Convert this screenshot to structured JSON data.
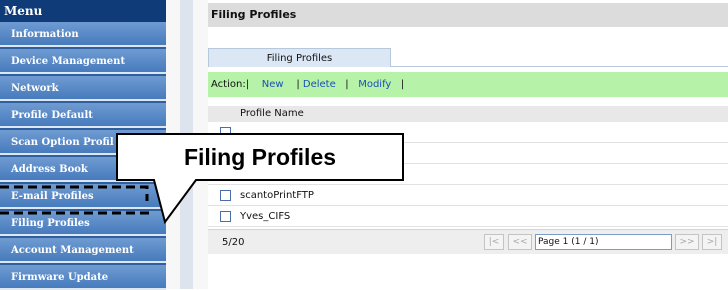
{
  "sidebar": {
    "header": "Menu",
    "items": [
      {
        "label": "Information"
      },
      {
        "label": "Device Management"
      },
      {
        "label": "Network"
      },
      {
        "label": "Profile Default"
      },
      {
        "label": "Scan Option Profil"
      },
      {
        "label": "Address Book"
      },
      {
        "label": "E-mail Profiles"
      },
      {
        "label": "Filing Profiles"
      },
      {
        "label": "Account Management"
      },
      {
        "label": "Firmware Update"
      }
    ]
  },
  "main": {
    "title": "Filing Profiles",
    "tab_label": "Filing Profiles",
    "action": {
      "prefix": "Action:|",
      "new_label": "New",
      "sep1": "|",
      "delete_label": "Delete",
      "sep2": "|",
      "modify_label": "Modify",
      "sep3": "|"
    },
    "list": {
      "column_header": "Profile Name",
      "rows": [
        {
          "name": "scantoPrintFTP"
        },
        {
          "name": "Yves_CIFS"
        }
      ]
    },
    "footer": {
      "count": "5/20",
      "first_label": "|<",
      "prev_label": "<<",
      "page_value": "Page 1 (1 / 1)",
      "next_label": ">>",
      "last_label": ">|"
    }
  },
  "callout": {
    "text": "Filing Profiles"
  },
  "colors": {
    "sidebar_bg": "#2f5f9f",
    "menu_header_bg": "#0f3c78",
    "action_bar_bg": "#b6f2a8",
    "link": "#1a4fb5"
  }
}
